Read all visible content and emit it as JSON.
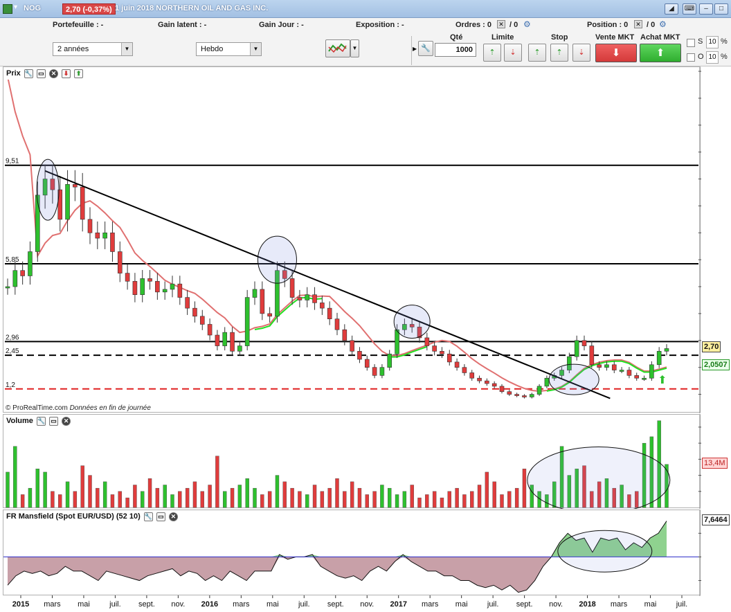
{
  "window": {
    "symbol": "NOG",
    "price_change": "2,70 (-0,37%)",
    "title": "1 juin 2018 NORTHERN OIL AND GAS INC."
  },
  "toolbar": {
    "portefeuille": "Portefeuille : -",
    "gain_latent": "Gain latent : -",
    "gain_jour": "Gain Jour : -",
    "exposition": "Exposition : -",
    "ordres": "Ordres : 0",
    "ordres_b": "/ 0",
    "position": "Position : 0",
    "position_b": "/ 0",
    "period_select": "2 années",
    "interval_select": "Hebdo",
    "qte_label": "Qté",
    "qte_value": "1000",
    "limite_label": "Limite",
    "stop_label": "Stop",
    "vente_label": "Vente MKT",
    "achat_label": "Achat MKT",
    "s_label": "S",
    "s_value": "10",
    "o_label": "O",
    "o_value": "10",
    "pct": "%"
  },
  "price_panel": {
    "title": "Prix",
    "credit_source": "© ProRealTime.com",
    "credit_note": "Données en fin de journée",
    "y_ticks": [
      "13",
      "12",
      "11",
      "10",
      "9",
      "8",
      "7",
      "6",
      "5",
      "4",
      "3",
      "2",
      "1"
    ],
    "levels": [
      {
        "label": "9,51",
        "value": 9.51,
        "style": "solid",
        "color": "#000000"
      },
      {
        "label": "5,85",
        "value": 5.85,
        "style": "solid",
        "color": "#000000"
      },
      {
        "label": "2,96",
        "value": 2.96,
        "style": "solid",
        "color": "#000000"
      },
      {
        "label": "2,45",
        "value": 2.45,
        "style": "dashed",
        "color": "#000000"
      },
      {
        "label": "1,2",
        "value": 1.2,
        "style": "dashed",
        "color": "#e02020"
      }
    ],
    "last_price_tag": "2,70",
    "ma_tag": "2,0507"
  },
  "volume_panel": {
    "title": "Volume",
    "y_ticks": [
      "25M",
      "20M",
      "15M",
      "10M",
      "5000k"
    ],
    "last_tag": "13,4M"
  },
  "mansfield_panel": {
    "title": "FR Mansfield (Spot EUR/USD) (52 10)",
    "y_ticks": [
      "5",
      "0",
      "-5"
    ],
    "last_tag": "7,6464"
  },
  "x_axis": {
    "labels": [
      "2015",
      "mars",
      "mai",
      "juil.",
      "sept.",
      "nov.",
      "2016",
      "mars",
      "mai",
      "juil.",
      "sept.",
      "nov.",
      "2017",
      "mars",
      "mai",
      "juil.",
      "sept.",
      "nov.",
      "2018",
      "mars",
      "mai",
      "juil."
    ]
  },
  "colors": {
    "up": "#2ec02e",
    "down": "#e03c3c",
    "ma_red": "#e07070",
    "ma_green": "#22e022",
    "mansfield_neg": "#c8a0a8",
    "mansfield_pos": "#8fd28f"
  },
  "chart_data": {
    "type": "line",
    "series": [
      {
        "name": "Prix",
        "values": [
          5.0,
          5.6,
          5.4,
          6.3,
          8.4,
          9.0,
          8.6,
          7.5,
          8.8,
          8.7,
          7.5,
          7.0,
          6.8,
          7.0,
          6.3,
          5.5,
          5.2,
          4.7,
          5.3,
          5.2,
          4.8,
          4.9,
          5.1,
          4.6,
          4.2,
          3.9,
          3.6,
          3.2,
          2.8,
          3.3,
          2.6,
          2.8,
          4.6,
          4.9,
          4.0,
          3.9,
          5.6,
          5.3,
          4.6,
          4.5,
          4.7,
          4.4,
          4.2,
          3.8,
          3.4,
          3.0,
          2.6,
          2.3,
          2.0,
          1.7,
          2.0,
          2.5,
          3.4,
          3.6,
          3.5,
          3.1,
          2.8,
          2.6,
          2.5,
          2.2,
          2.0,
          1.8,
          1.6,
          1.5,
          1.4,
          1.3,
          1.1,
          1.0,
          0.95,
          0.9,
          1.0,
          1.3,
          1.6,
          1.7,
          1.9,
          2.4,
          3.0,
          2.8,
          2.1,
          2.0,
          2.1,
          1.9,
          1.9,
          1.7,
          1.6,
          1.6,
          2.1,
          2.6,
          2.7
        ]
      },
      {
        "name": "Volume (M)",
        "values": [
          11,
          19,
          4,
          6,
          12,
          11,
          5,
          4,
          8,
          5,
          13,
          10,
          6,
          8,
          4,
          5,
          3,
          7,
          5,
          9,
          6,
          7,
          4,
          5,
          6,
          8,
          5,
          7,
          16,
          5,
          6,
          7,
          9,
          6,
          4,
          5,
          10,
          8,
          6,
          5,
          4,
          7,
          5,
          6,
          9,
          5,
          8,
          6,
          4,
          5,
          7,
          6,
          4,
          5,
          7,
          3,
          4,
          5,
          3,
          5,
          6,
          4,
          5,
          7,
          11,
          8,
          4,
          5,
          6,
          12,
          7,
          5,
          4,
          8,
          19,
          10,
          12,
          13,
          5,
          8,
          9,
          6,
          7,
          4,
          5,
          20,
          22,
          27,
          13.4
        ]
      },
      {
        "name": "FR Mansfield",
        "values": [
          -6,
          -4,
          -3,
          -3.5,
          -3,
          -4,
          -3.5,
          -2,
          -3,
          -3,
          -4,
          -5,
          -3,
          -3.5,
          -4,
          -4.5,
          -5,
          -4,
          -3.5,
          -3,
          -2.5,
          -4,
          -3,
          -3.5,
          -5,
          -4,
          -5,
          -3,
          -4,
          -5,
          -3,
          -3,
          -3,
          0.5,
          -0.5,
          0,
          0,
          0.5,
          -2,
          -3,
          -4,
          -4.5,
          -4,
          -5,
          -3,
          -2,
          -3,
          -1,
          0.5,
          -1,
          -2,
          -3,
          -3,
          -4,
          -4,
          -5,
          -5,
          -6,
          -6.5,
          -6,
          -7,
          -6,
          -7.5,
          -7,
          -5,
          -2,
          0,
          3,
          5,
          3.5,
          4,
          1,
          4,
          3.5,
          4,
          1.5,
          3,
          2,
          4,
          5,
          7.6
        ]
      }
    ],
    "ylim": [
      0.5,
      13
    ],
    "xlabel": "",
    "ylabel": ""
  }
}
